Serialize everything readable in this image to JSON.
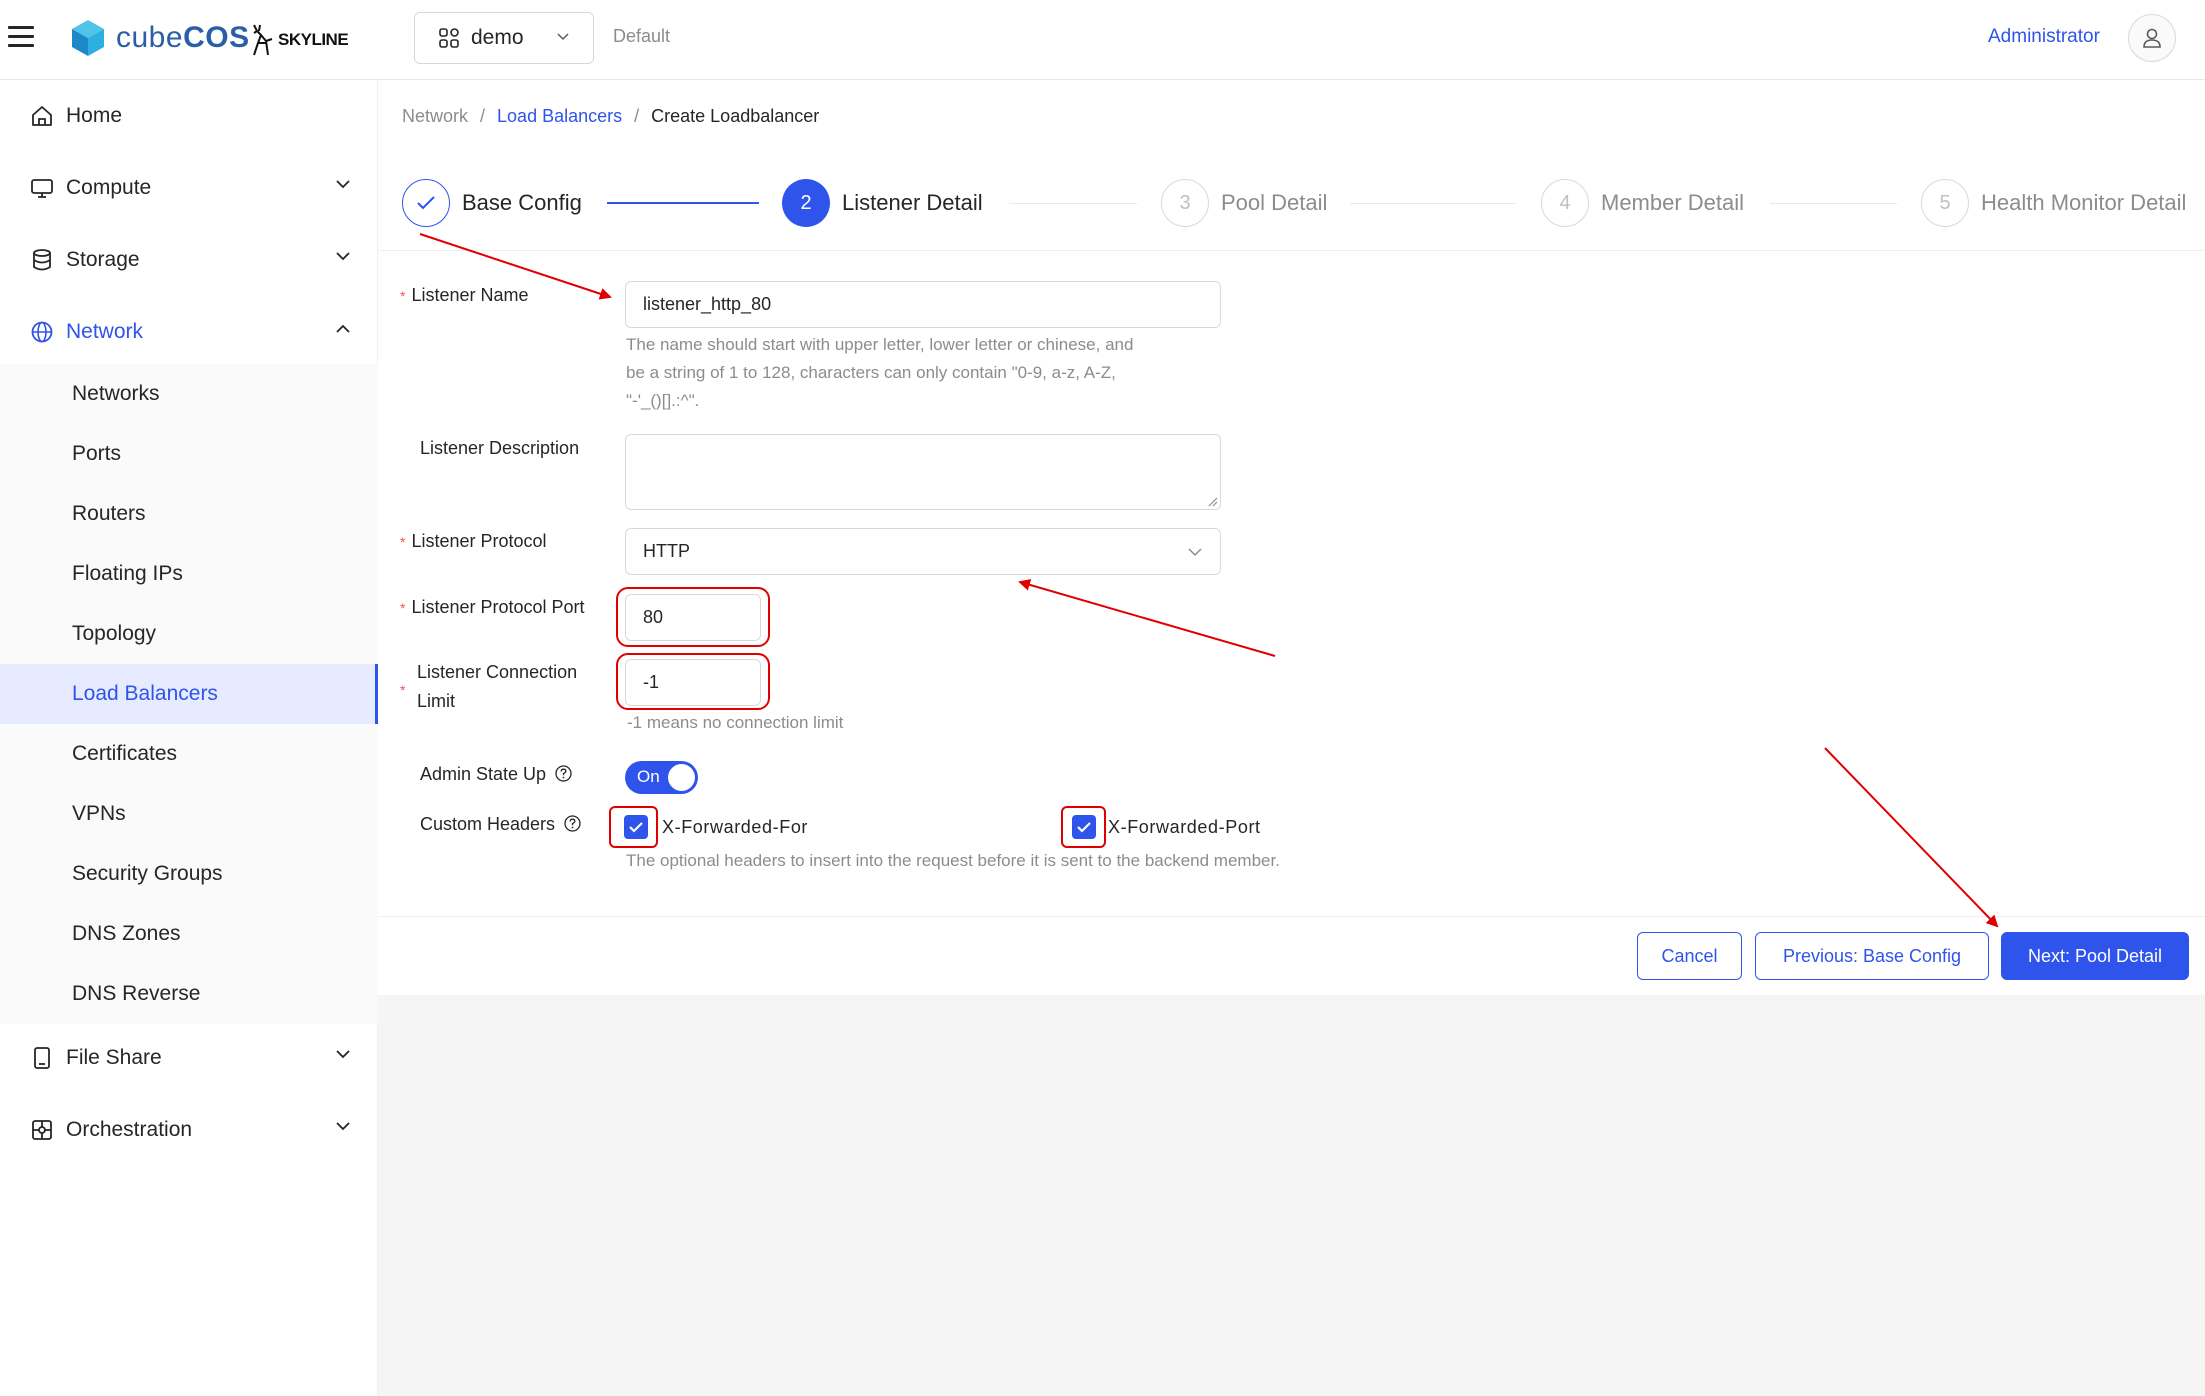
{
  "header": {
    "brand_prefix": "cube",
    "brand_suffix": "COS",
    "partner": "SKYLINE",
    "project": "demo",
    "domain": "Default",
    "user": "Administrator"
  },
  "sidebar": {
    "home": "Home",
    "compute": "Compute",
    "storage": "Storage",
    "network": "Network",
    "network_items": [
      "Networks",
      "Ports",
      "Routers",
      "Floating IPs",
      "Topology",
      "Load Balancers",
      "Certificates",
      "VPNs",
      "Security Groups",
      "DNS Zones",
      "DNS Reverse"
    ],
    "file_share": "File Share",
    "orchestration": "Orchestration"
  },
  "breadcrumb": {
    "root": "Network",
    "parent": "Load Balancers",
    "current": "Create Loadbalancer"
  },
  "steps": [
    {
      "num": "",
      "label": "Base Config",
      "state": "done"
    },
    {
      "num": "2",
      "label": "Listener Detail",
      "state": "active"
    },
    {
      "num": "3",
      "label": "Pool Detail",
      "state": "wait"
    },
    {
      "num": "4",
      "label": "Member Detail",
      "state": "wait"
    },
    {
      "num": "5",
      "label": "Health Monitor Detail",
      "state": "wait"
    }
  ],
  "form": {
    "name_label": "Listener Name",
    "name_value": "listener_http_80",
    "name_help_1": "The name should start with upper letter, lower letter or chinese, and",
    "name_help_2": "be a string of 1 to 128, characters can only contain \"0-9, a-z, A-Z,",
    "name_help_3": "\"-'_()[].:^\".",
    "desc_label": "Listener Description",
    "protocol_label": "Listener Protocol",
    "protocol_value": "HTTP",
    "port_label": "Listener Protocol Port",
    "port_value": "80",
    "conn_label_1": "Listener Connection",
    "conn_label_2": "Limit",
    "conn_value": "-1",
    "conn_help": "-1 means no connection limit",
    "admin_label": "Admin State Up",
    "admin_value": "On",
    "headers_label": "Custom Headers",
    "header_1": "X-Forwarded-For",
    "header_2": "X-Forwarded-Port",
    "headers_help": "The optional headers to insert into the request before it is sent to the backend member."
  },
  "footer": {
    "cancel": "Cancel",
    "previous": "Previous: Base Config",
    "next": "Next: Pool Detail"
  },
  "colors": {
    "primary": "#2f54eb",
    "annotation": "#e00000"
  }
}
